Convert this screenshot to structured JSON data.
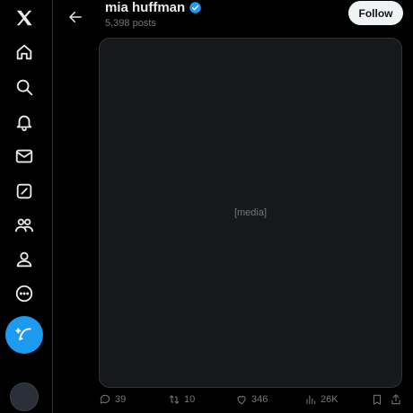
{
  "header": {
    "back_icon": "arrow-left-icon",
    "display_name": "mia huffman",
    "verified_icon": "verified-badge-icon",
    "post_count": "5,398 posts",
    "follow_label": "Follow"
  },
  "sidebar": {
    "items": [
      {
        "icon": "x-logo-icon"
      },
      {
        "icon": "home-icon"
      },
      {
        "icon": "search-icon"
      },
      {
        "icon": "bell-icon"
      },
      {
        "icon": "mail-icon"
      },
      {
        "icon": "grok-icon"
      },
      {
        "icon": "communities-icon"
      },
      {
        "icon": "profile-icon"
      },
      {
        "icon": "more-icon"
      }
    ],
    "compose_icon": "feather-plus-icon"
  },
  "media": {
    "placeholder": "[media]"
  },
  "actions": {
    "replies": "39",
    "reposts": "10",
    "likes": "346",
    "views": "26K"
  },
  "colors": {
    "accent": "#1d9bf0",
    "background": "#000000",
    "text": "#e7e9ea",
    "muted": "#71767b",
    "border": "#2f3336"
  }
}
